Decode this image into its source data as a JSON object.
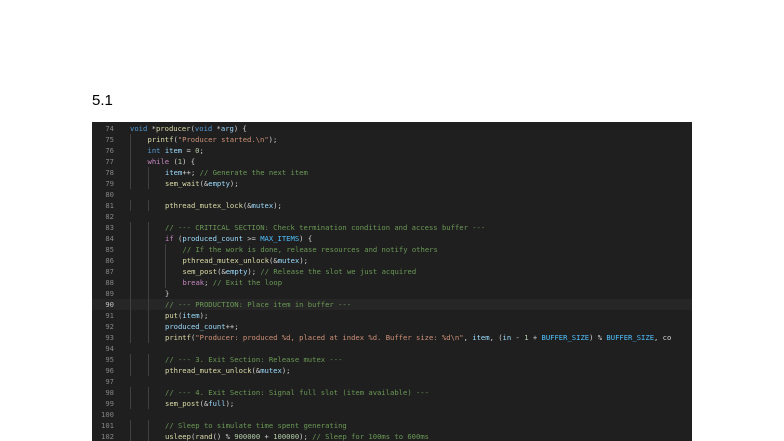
{
  "page": {
    "heading": "5.1"
  },
  "editor": {
    "lines": [
      {
        "n": "74",
        "indent": 0,
        "tokens": [
          [
            "kw",
            "void"
          ],
          [
            "def",
            " *"
          ],
          [
            "fn",
            "producer"
          ],
          [
            "def",
            "("
          ],
          [
            "kw",
            "void"
          ],
          [
            "def",
            " *"
          ],
          [
            "var",
            "arg"
          ],
          [
            "def",
            ") {"
          ]
        ]
      },
      {
        "n": "75",
        "indent": 1,
        "tokens": [
          [
            "fn",
            "printf"
          ],
          [
            "def",
            "("
          ],
          [
            "str",
            "\"Producer started.\\n\""
          ],
          [
            "def",
            ");"
          ]
        ]
      },
      {
        "n": "76",
        "indent": 1,
        "tokens": [
          [
            "kw",
            "int"
          ],
          [
            "def",
            " "
          ],
          [
            "var",
            "item"
          ],
          [
            "def",
            " = "
          ],
          [
            "num",
            "0"
          ],
          [
            "def",
            ";"
          ]
        ]
      },
      {
        "n": "77",
        "indent": 1,
        "tokens": [
          [
            "ctl",
            "while"
          ],
          [
            "def",
            " ("
          ],
          [
            "num",
            "1"
          ],
          [
            "def",
            ") {"
          ]
        ]
      },
      {
        "n": "78",
        "indent": 2,
        "tokens": [
          [
            "var",
            "item"
          ],
          [
            "def",
            "++; "
          ],
          [
            "cmt",
            "// Generate the next item"
          ]
        ]
      },
      {
        "n": "79",
        "indent": 2,
        "tokens": [
          [
            "fn",
            "sem_wait"
          ],
          [
            "def",
            "(&"
          ],
          [
            "var",
            "empty"
          ],
          [
            "def",
            ");"
          ]
        ]
      },
      {
        "n": "80",
        "indent": 0,
        "tokens": []
      },
      {
        "n": "81",
        "indent": 2,
        "tokens": [
          [
            "fn",
            "pthread_mutex_lock"
          ],
          [
            "def",
            "(&"
          ],
          [
            "var",
            "mutex"
          ],
          [
            "def",
            ");"
          ]
        ]
      },
      {
        "n": "82",
        "indent": 0,
        "tokens": []
      },
      {
        "n": "83",
        "indent": 2,
        "tokens": [
          [
            "cmt",
            "// --- CRITICAL SECTION: Check termination condition and access buffer ---"
          ]
        ]
      },
      {
        "n": "84",
        "indent": 2,
        "tokens": [
          [
            "ctl",
            "if"
          ],
          [
            "def",
            " ("
          ],
          [
            "var",
            "produced_count"
          ],
          [
            "def",
            " >= "
          ],
          [
            "mac",
            "MAX_ITEMS"
          ],
          [
            "def",
            ") {"
          ]
        ]
      },
      {
        "n": "85",
        "indent": 3,
        "tokens": [
          [
            "cmt",
            "// If the work is done, release resources and notify others"
          ]
        ]
      },
      {
        "n": "86",
        "indent": 3,
        "tokens": [
          [
            "fn",
            "pthread_mutex_unlock"
          ],
          [
            "def",
            "(&"
          ],
          [
            "var",
            "mutex"
          ],
          [
            "def",
            ");"
          ]
        ]
      },
      {
        "n": "87",
        "indent": 3,
        "tokens": [
          [
            "fn",
            "sem_post"
          ],
          [
            "def",
            "(&"
          ],
          [
            "var",
            "empty"
          ],
          [
            "def",
            "); "
          ],
          [
            "cmt",
            "// Release the slot we just acquired"
          ]
        ]
      },
      {
        "n": "88",
        "indent": 3,
        "tokens": [
          [
            "ctl",
            "break"
          ],
          [
            "def",
            "; "
          ],
          [
            "cmt",
            "// Exit the loop"
          ]
        ]
      },
      {
        "n": "89",
        "indent": 2,
        "tokens": [
          [
            "def",
            "}"
          ]
        ]
      },
      {
        "n": "90",
        "indent": 2,
        "current": true,
        "tokens": [
          [
            "cmt",
            "// --- PRODUCTION: Place item in buffer ---"
          ]
        ]
      },
      {
        "n": "91",
        "indent": 2,
        "tokens": [
          [
            "fn",
            "put"
          ],
          [
            "def",
            "("
          ],
          [
            "var",
            "item"
          ],
          [
            "def",
            ");"
          ]
        ]
      },
      {
        "n": "92",
        "indent": 2,
        "tokens": [
          [
            "var",
            "produced_count"
          ],
          [
            "def",
            "++;"
          ]
        ]
      },
      {
        "n": "93",
        "indent": 2,
        "tokens": [
          [
            "fn",
            "printf"
          ],
          [
            "def",
            "("
          ],
          [
            "str",
            "\"Producer: produced %d, placed at index %d. Buffer size: %d\\n\""
          ],
          [
            "def",
            ", "
          ],
          [
            "var",
            "item"
          ],
          [
            "def",
            ", ("
          ],
          [
            "var",
            "in"
          ],
          [
            "def",
            " - "
          ],
          [
            "num",
            "1"
          ],
          [
            "def",
            " + "
          ],
          [
            "mac",
            "BUFFER_SIZE"
          ],
          [
            "def",
            ") % "
          ],
          [
            "mac",
            "BUFFER_SIZE"
          ],
          [
            "def",
            ", co"
          ]
        ]
      },
      {
        "n": "94",
        "indent": 0,
        "tokens": []
      },
      {
        "n": "95",
        "indent": 2,
        "tokens": [
          [
            "cmt",
            "// --- 3. Exit Section: Release mutex ---"
          ]
        ]
      },
      {
        "n": "96",
        "indent": 2,
        "tokens": [
          [
            "fn",
            "pthread_mutex_unlock"
          ],
          [
            "def",
            "(&"
          ],
          [
            "var",
            "mutex"
          ],
          [
            "def",
            ");"
          ]
        ]
      },
      {
        "n": "97",
        "indent": 0,
        "tokens": []
      },
      {
        "n": "98",
        "indent": 2,
        "tokens": [
          [
            "cmt",
            "// --- 4. Exit Section: Signal full slot (item available) ---"
          ]
        ]
      },
      {
        "n": "99",
        "indent": 2,
        "tokens": [
          [
            "fn",
            "sem_post"
          ],
          [
            "def",
            "(&"
          ],
          [
            "var",
            "full"
          ],
          [
            "def",
            ");"
          ]
        ]
      },
      {
        "n": "100",
        "indent": 0,
        "tokens": []
      },
      {
        "n": "101",
        "indent": 2,
        "tokens": [
          [
            "cmt",
            "// Sleep to simulate time spent generating"
          ]
        ]
      },
      {
        "n": "102",
        "indent": 2,
        "tokens": [
          [
            "fn",
            "usleep"
          ],
          [
            "def",
            "("
          ],
          [
            "fn",
            "rand"
          ],
          [
            "def",
            "() % "
          ],
          [
            "num",
            "900000"
          ],
          [
            "def",
            " + "
          ],
          [
            "num",
            "100000"
          ],
          [
            "def",
            "); "
          ],
          [
            "cmt",
            "// Sleep for 100ms to 600ms"
          ]
        ]
      }
    ]
  }
}
